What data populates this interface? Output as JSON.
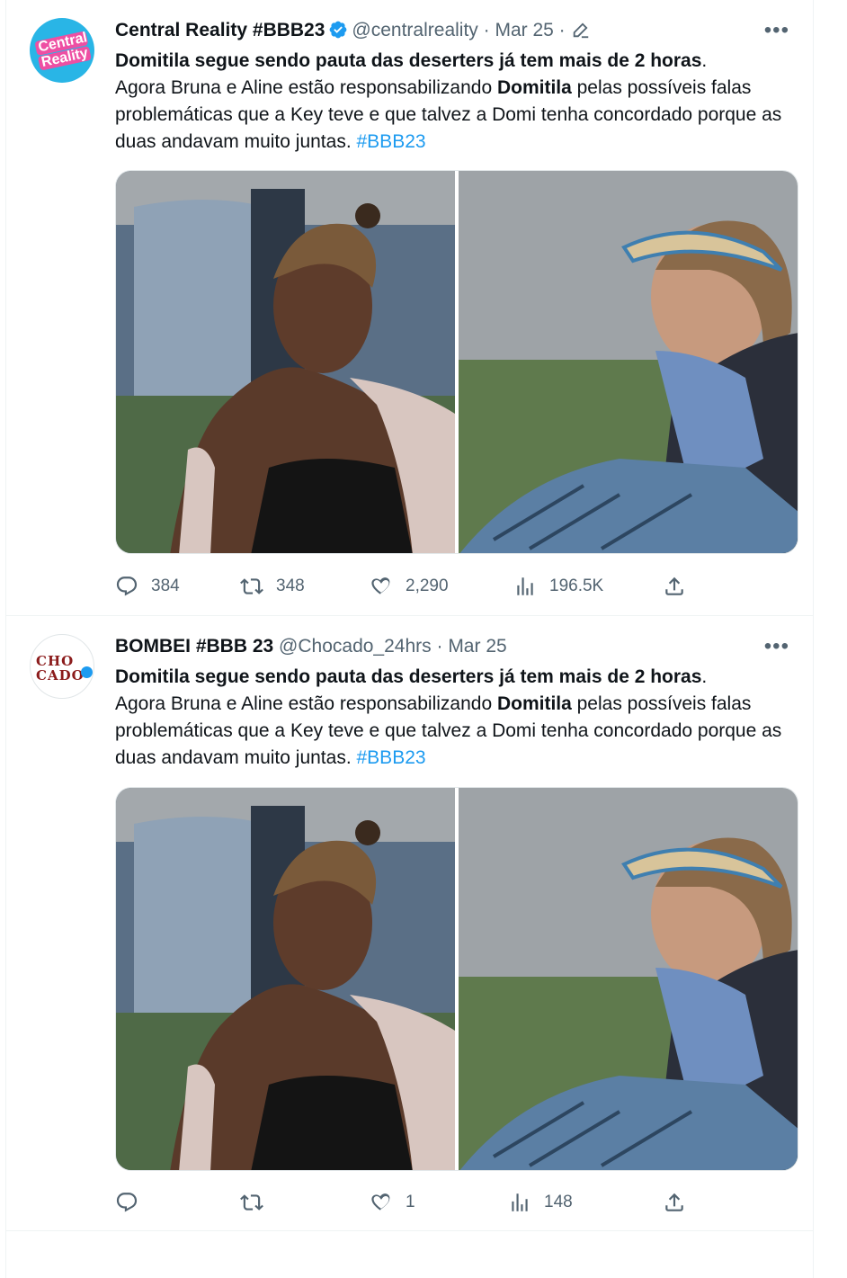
{
  "tweets": [
    {
      "display_name": "Central Reality #BBB23",
      "handle": "@centralreality",
      "date": "Mar 25",
      "avatar_text": [
        "Central",
        "Reality"
      ],
      "text_bold": "Domitila segue sendo pauta das deserters já tem mais de 2 horas",
      "text_after_bold": ".",
      "text_line2_a": "Agora Bruna e Aline estão responsabilizando ",
      "text_line2_bold": "Domitila",
      "text_line2_b": " pelas possíveis falas problemáticas que a Key teve e que talvez a Domi tenha concordado porque as duas andavam muito juntas. ",
      "hashtag": "#BBB23",
      "replies": "384",
      "retweets": "348",
      "likes": "2,290",
      "views": "196.5K"
    },
    {
      "display_name": "BOMBEI #BBB 23",
      "handle": "@Chocado_24hrs",
      "date": "Mar 25",
      "avatar_text": [
        "CHO",
        "CADO"
      ],
      "text_bold": "Domitila segue sendo pauta das deserters já tem mais de 2 horas",
      "text_after_bold": ".",
      "text_line2_a": "Agora Bruna e Aline estão responsabilizando ",
      "text_line2_bold": "Domitila",
      "text_line2_b": " pelas possíveis falas problemáticas que a Key teve e que talvez a Domi tenha concordado porque as duas andavam muito juntas. ",
      "hashtag": "#BBB23",
      "replies": "",
      "retweets": "",
      "likes": "1",
      "views": "148"
    }
  ],
  "colors": {
    "accent": "#1d9bf0",
    "secondary_text": "#536471",
    "primary_text": "#0f1419",
    "border": "#eff3f4"
  },
  "icons": [
    "verified-badge-icon",
    "edit-pencil-icon",
    "more-icon",
    "reply-icon",
    "retweet-icon",
    "like-icon",
    "views-icon",
    "share-icon"
  ]
}
